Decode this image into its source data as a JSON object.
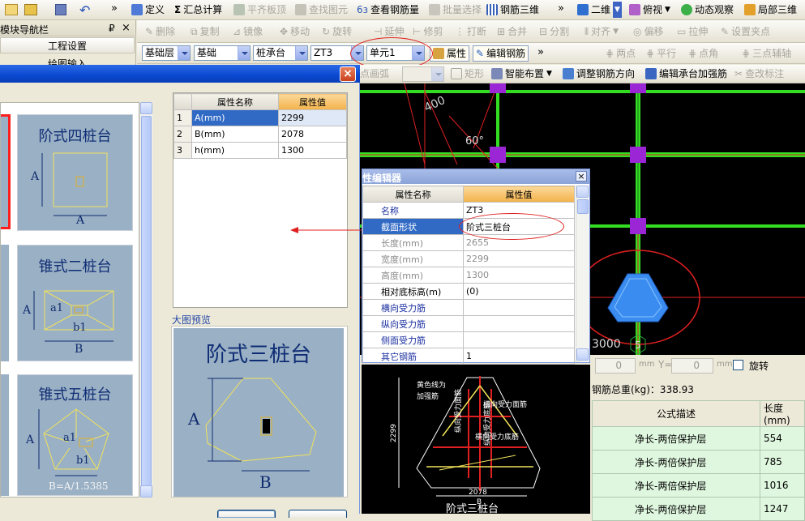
{
  "toolbar1": {
    "items": [
      {
        "label": "定义",
        "disabled": false
      },
      {
        "label": "汇总计算",
        "disabled": false
      },
      {
        "label": "平齐板顶",
        "disabled": true
      },
      {
        "label": "查找图元",
        "disabled": true
      },
      {
        "label": "查看钢筋量",
        "disabled": false
      },
      {
        "label": "批量选择",
        "disabled": true
      },
      {
        "label": "钢筋三维",
        "disabled": false
      }
    ],
    "view_select": "二维",
    "view_mode": "俯视",
    "dynamic_label": "动态观察",
    "local3d_label": "局部三维",
    "more": "»"
  },
  "navigator": {
    "title": "模块导航栏",
    "pin": "₽",
    "close": "×",
    "item": "工程设置",
    "item2": "绘图输入"
  },
  "toolbar2": {
    "items": [
      {
        "label": "删除"
      },
      {
        "label": "复制"
      },
      {
        "label": "镜像"
      },
      {
        "label": "移动"
      },
      {
        "label": "旋转"
      },
      {
        "label": "延伸"
      },
      {
        "label": "修剪"
      },
      {
        "label": "打断"
      },
      {
        "label": "合并"
      },
      {
        "label": "分割"
      },
      {
        "label": "对齐"
      },
      {
        "label": "偏移"
      },
      {
        "label": "拉伸"
      },
      {
        "label": "设置夹点"
      }
    ]
  },
  "toolbar3": {
    "layer": "基础层",
    "category": "基础",
    "type": "桩承台",
    "element": "ZT3",
    "unit": "单元1",
    "props_label": "属性",
    "edit_rebar_label": "编辑钢筋",
    "snap": [
      {
        "label": "两点"
      },
      {
        "label": "平行"
      },
      {
        "label": "点角"
      },
      {
        "label": "三点辅轴"
      }
    ]
  },
  "toolbar4": {
    "arc_label": "点画弧",
    "rect_label": "矩形",
    "smart_label": "智能布置",
    "adjust_label": "调整钢筋方向",
    "edit_cap_label": "编辑承台加强筋",
    "check_label": "查改标注"
  },
  "dialog": {
    "close": "×"
  },
  "shapes": [
    {
      "title": "阶式四桩台",
      "a": "A"
    },
    {
      "title": "锥式二桩台",
      "a": "A",
      "a1": "a1",
      "b1": "b1",
      "b": "B"
    },
    {
      "title": "锥式五桩台",
      "a": "A",
      "a1": "a1",
      "b1": "b1",
      "formula": "B=A/1.5385"
    }
  ],
  "shape_params": {
    "headers": [
      "属性名称",
      "属性值"
    ],
    "rows": [
      {
        "idx": "1",
        "name": "A(mm)",
        "value": "2299"
      },
      {
        "idx": "2",
        "name": "B(mm)",
        "value": "2078"
      },
      {
        "idx": "3",
        "name": "h(mm)",
        "value": "1300"
      }
    ]
  },
  "preview": {
    "section_label": "大图预览",
    "title": "阶式三桩台",
    "a": "A",
    "b": "B"
  },
  "prop_editor": {
    "title": "性编辑器",
    "headers": [
      "属性名称",
      "属性值"
    ],
    "rows": [
      {
        "name": "名称",
        "value": "ZT3",
        "style": "link"
      },
      {
        "name": "截面形状",
        "value": "阶式三桩台",
        "style": "selected"
      },
      {
        "name": "长度(mm)",
        "value": "2655",
        "style": "gray"
      },
      {
        "name": "宽度(mm)",
        "value": "2299",
        "style": "gray"
      },
      {
        "name": "高度(mm)",
        "value": "1300",
        "style": "gray"
      },
      {
        "name": "相对底标高(m)",
        "value": "(0)",
        "style": "normal"
      },
      {
        "name": "横向受力筋",
        "value": "",
        "style": "link"
      },
      {
        "name": "纵向受力筋",
        "value": "",
        "style": "link"
      },
      {
        "name": "侧面受力筋",
        "value": "",
        "style": "link"
      },
      {
        "name": "其它钢筋",
        "value": "1",
        "style": "link"
      }
    ]
  },
  "cad": {
    "dim_400": "400",
    "angle": "60°",
    "dim_3000": "3000",
    "axis_5": "5"
  },
  "cad_detail": {
    "note1": "黄色线为",
    "note2": "加强筋",
    "transverse": "横向受力面筋",
    "longitudinal_face": "纵向受力面筋",
    "longitudinal_bottom": "纵向受力底筋",
    "transverse_bottom": "横向受力底筋",
    "dim_a": "2299",
    "dim_b": "2078",
    "label_b": "B",
    "title": "阶式三桩台"
  },
  "coord_bar": {
    "x_val": "0",
    "mm": "mm",
    "y_label": "Y=",
    "y_val": "0",
    "mm2": "mm",
    "rotate": "旋转"
  },
  "rebar": {
    "total_label": "钢筋总重(kg)：338.93",
    "headers": [
      "公式描述",
      "长度(mm)"
    ],
    "rows": [
      {
        "desc": "净长-两倍保护层",
        "len": "554"
      },
      {
        "desc": "净长-两倍保护层",
        "len": "785"
      },
      {
        "desc": "净长-两倍保护层",
        "len": "1016"
      },
      {
        "desc": "净长-两倍保护层",
        "len": "1247"
      }
    ]
  },
  "colors": {
    "cad_bg": "#000000",
    "beam": "#33dd22",
    "column": "#9a26d6",
    "highlight": "#e02020",
    "card": "#9ab0c5",
    "title_blue": "#0f2d74"
  }
}
